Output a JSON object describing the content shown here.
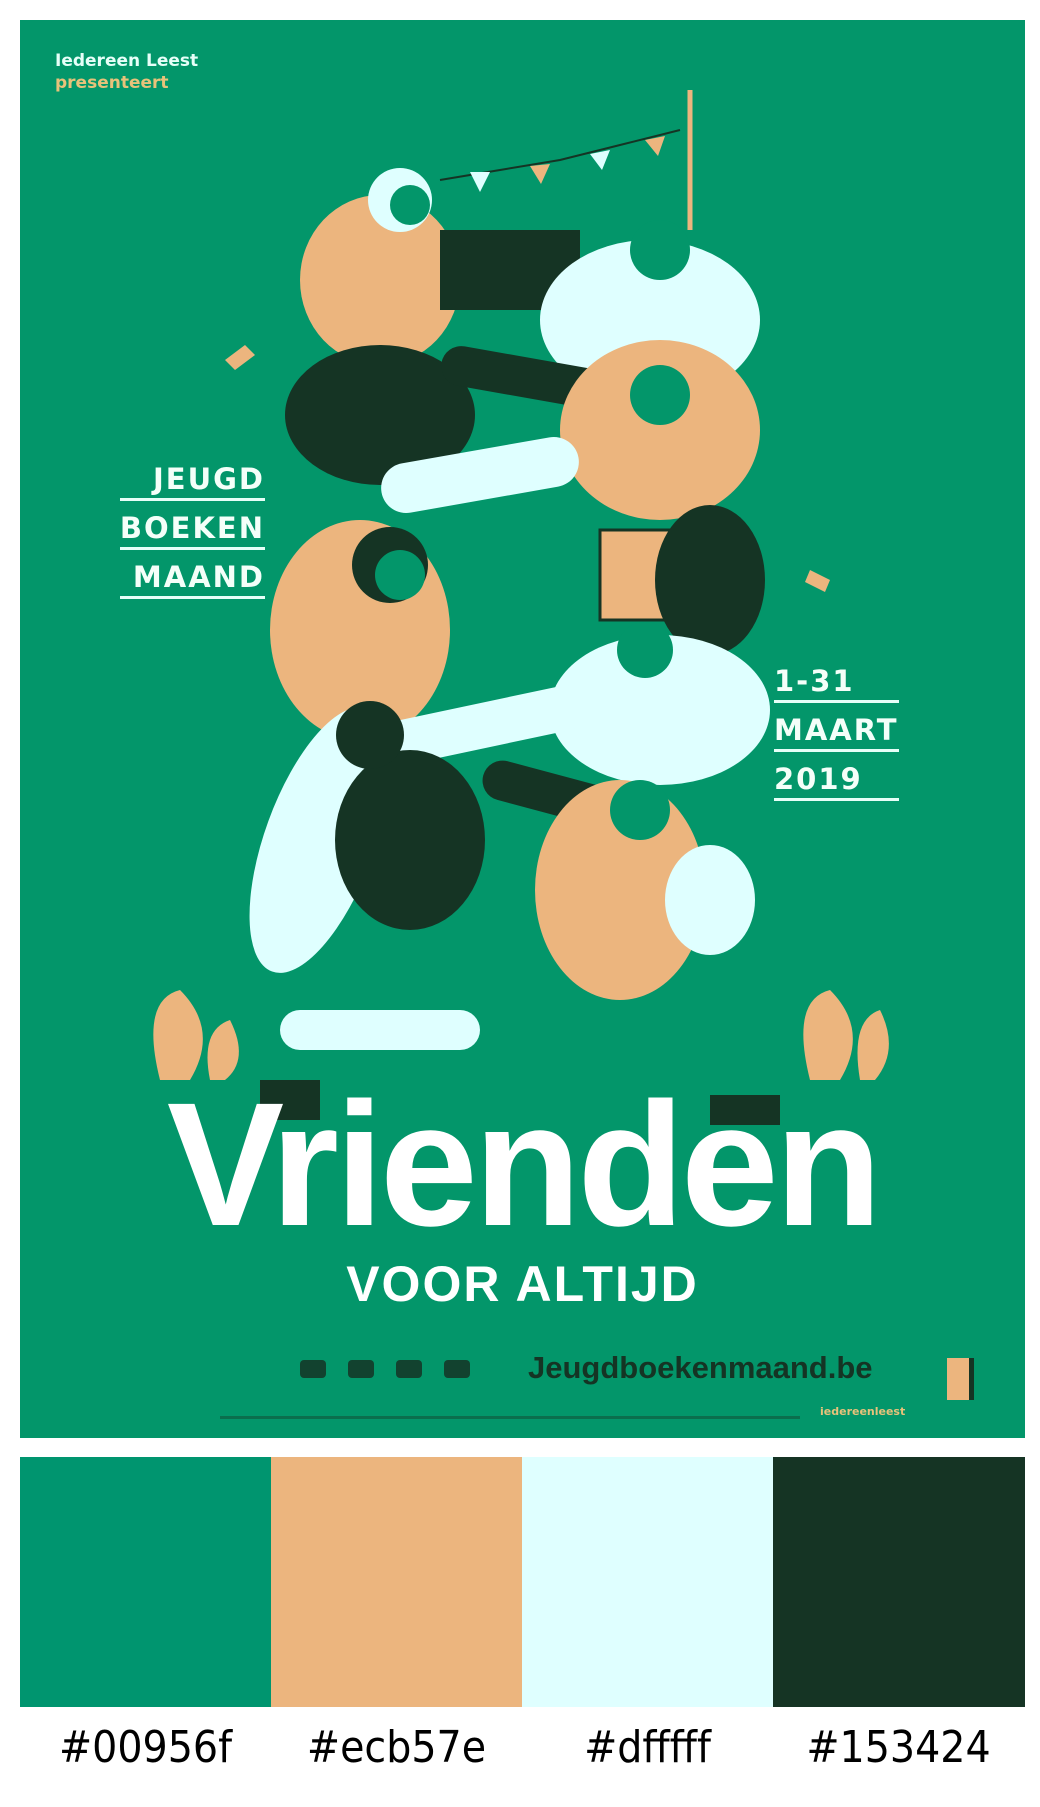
{
  "poster": {
    "publisher": "Iedereen Leest",
    "presents": "presenteert",
    "event_lines": [
      "JEUGD",
      "BOEKEN",
      "MAAND"
    ],
    "date_lines": [
      "1-31",
      "MAART",
      "2019"
    ],
    "title": "Vrienden",
    "subtitle": "VOOR ALTIJD",
    "website": "Jeugdboekenmaand.be",
    "footer_small": "iedereenleest",
    "background": "#03966a"
  },
  "palette": [
    {
      "hex": "#00956f",
      "label": "#00956f"
    },
    {
      "hex": "#ecb57e",
      "label": "#ecb57e"
    },
    {
      "hex": "#dfffff",
      "label": "#dfffff"
    },
    {
      "hex": "#153424",
      "label": "#153424"
    }
  ]
}
